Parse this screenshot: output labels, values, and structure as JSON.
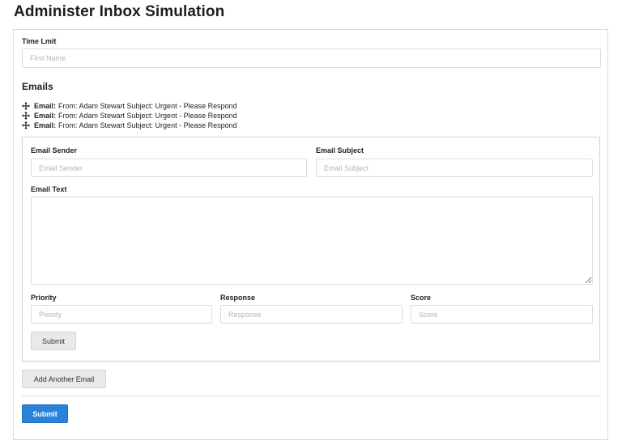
{
  "page": {
    "title": "Administer Inbox Simulation"
  },
  "time_limit": {
    "label": "Time Lmit",
    "placeholder": "First Name",
    "value": ""
  },
  "emails_section": {
    "heading": "Emails",
    "items": [
      {
        "prefix": "Email:",
        "text": "From: Adam Stewart Subject: Urgent - Please Respond",
        "icon": "move-icon"
      },
      {
        "prefix": "Email:",
        "text": "From: Adam Stewart Subject: Urgent - Please Respond",
        "icon": "move-icon"
      },
      {
        "prefix": "Email:",
        "text": "From: Adam Stewart Subject: Urgent - Please Respond",
        "icon": "move-icon"
      }
    ]
  },
  "email_form": {
    "sender": {
      "label": "Email Sender",
      "placeholder": "Email Sender",
      "value": ""
    },
    "subject": {
      "label": "Email Subject",
      "placeholder": "Email Subject",
      "value": ""
    },
    "text": {
      "label": "Email Text",
      "value": ""
    },
    "priority": {
      "label": "Priority",
      "placeholder": "Priority",
      "value": ""
    },
    "response": {
      "label": "Response",
      "placeholder": "Response",
      "value": ""
    },
    "score": {
      "label": "Score",
      "placeholder": "Score",
      "value": ""
    },
    "submit_label": "Submit"
  },
  "add_email_label": "Add Another Email",
  "main_submit_label": "Submit",
  "colors": {
    "primary": "#2a82d9",
    "border": "#dcdcdc",
    "secondary_button": "#e9e9e9"
  }
}
